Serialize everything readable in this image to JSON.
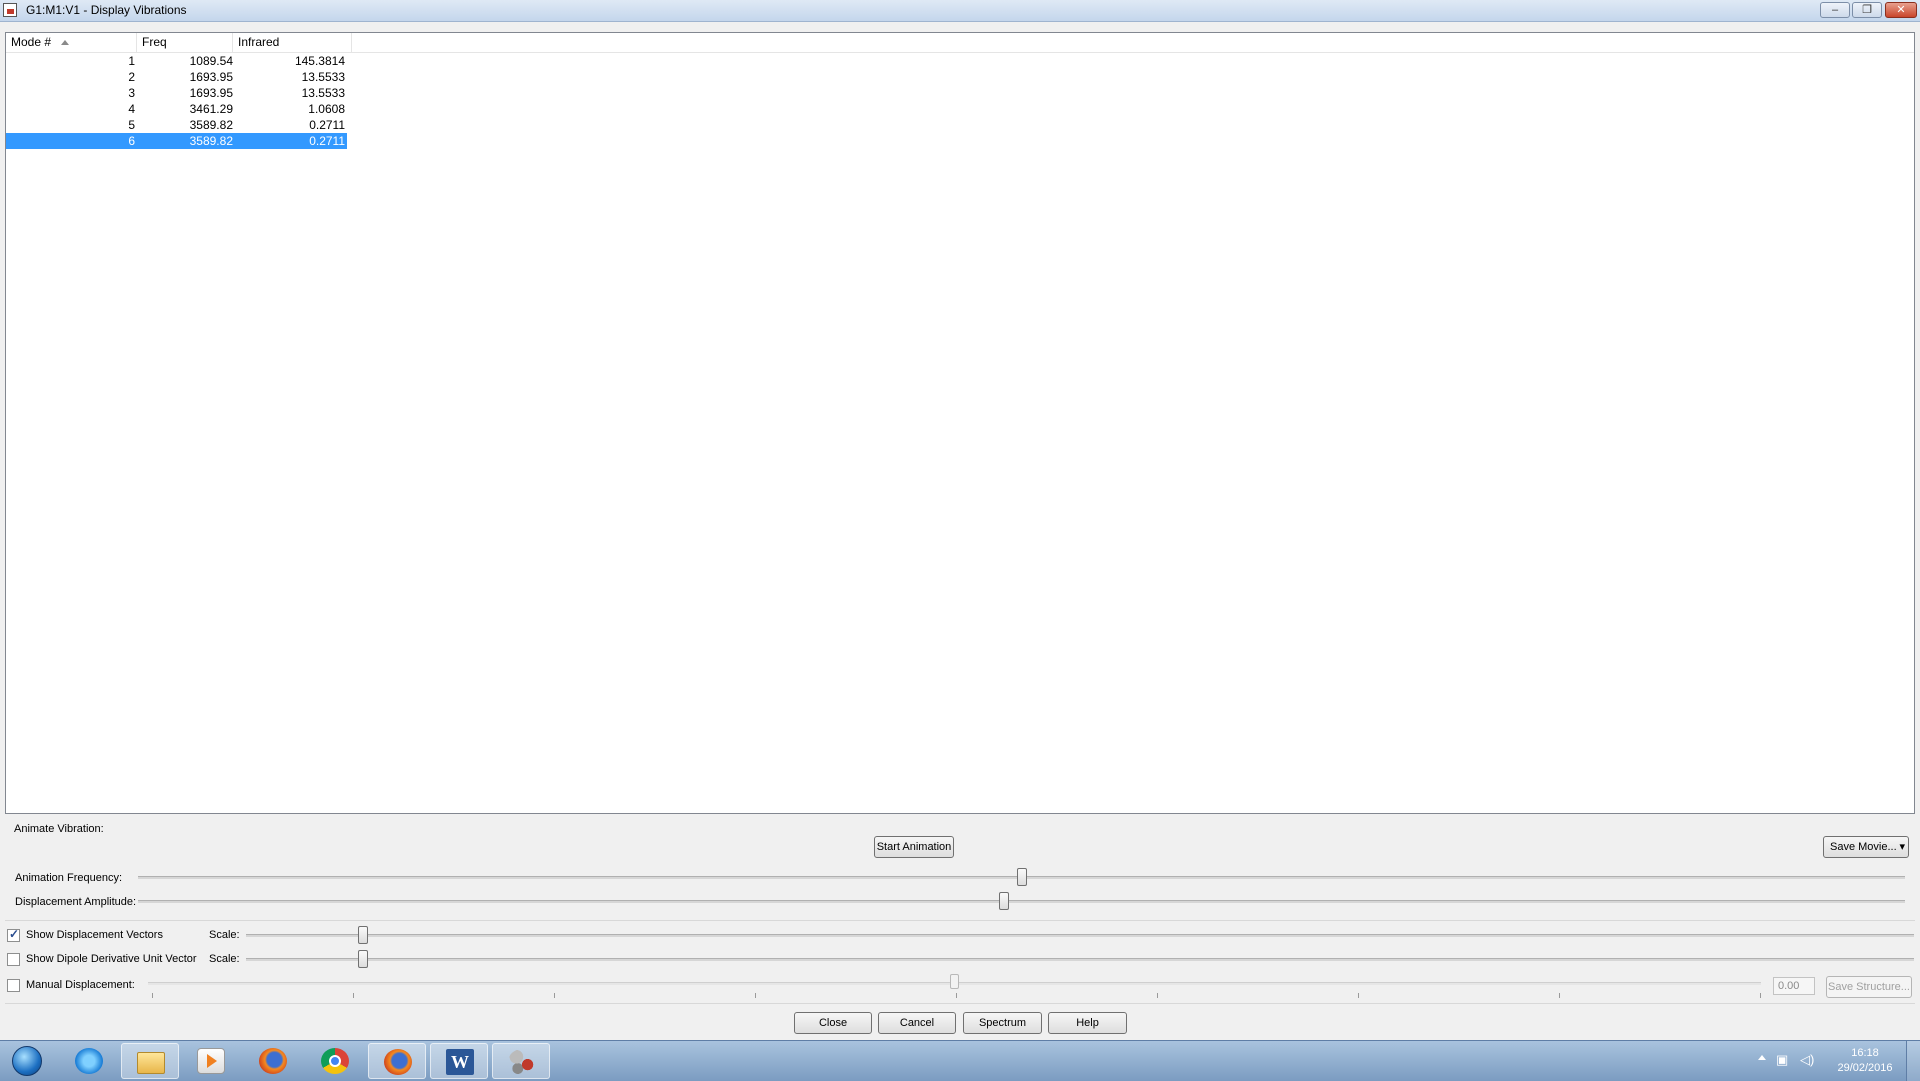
{
  "window": {
    "title": "G1:M1:V1 - Display Vibrations",
    "minimize_label": "–",
    "maximize_label": "❐",
    "close_label": "✕"
  },
  "table": {
    "columns": [
      "Mode #",
      "Freq",
      "Infrared"
    ],
    "rows": [
      {
        "mode": "1",
        "freq": "1089.54",
        "ir": "145.3814"
      },
      {
        "mode": "2",
        "freq": "1693.95",
        "ir": "13.5533"
      },
      {
        "mode": "3",
        "freq": "1693.95",
        "ir": "13.5533"
      },
      {
        "mode": "4",
        "freq": "3461.29",
        "ir": "1.0608"
      },
      {
        "mode": "5",
        "freq": "3589.82",
        "ir": "0.2711"
      },
      {
        "mode": "6",
        "freq": "3589.82",
        "ir": "0.2711"
      }
    ],
    "selected_row_index": 5
  },
  "animate": {
    "section_label": "Animate Vibration:",
    "start_button": "Start Animation",
    "save_movie_button": "Save Movie...",
    "frequency_label": "Animation Frequency:",
    "frequency_value": 0.5,
    "amplitude_label": "Displacement Amplitude:",
    "amplitude_value": 0.49
  },
  "options": {
    "show_displacement_vectors": {
      "label": "Show Displacement Vectors",
      "checked": true,
      "scale_label": "Scale:",
      "scale_value": 0.07
    },
    "show_dipole_vector": {
      "label": "Show Dipole Derivative Unit Vector",
      "checked": false,
      "scale_label": "Scale:",
      "scale_value": 0.07
    },
    "manual_displacement": {
      "label": "Manual Displacement:",
      "checked": false,
      "value": "0.00",
      "value_fraction": 0.5,
      "save_structure_button": "Save Structure..."
    }
  },
  "buttons": {
    "close": "Close",
    "cancel": "Cancel",
    "spectrum": "Spectrum",
    "help": "Help"
  },
  "taskbar": {
    "apps": [
      "start-orb",
      "internet-explorer",
      "file-explorer",
      "media-player",
      "firefox",
      "chrome",
      "firefox-active",
      "word",
      "gaussview"
    ],
    "clock_time": "16:18",
    "clock_date": "29/02/2016"
  }
}
